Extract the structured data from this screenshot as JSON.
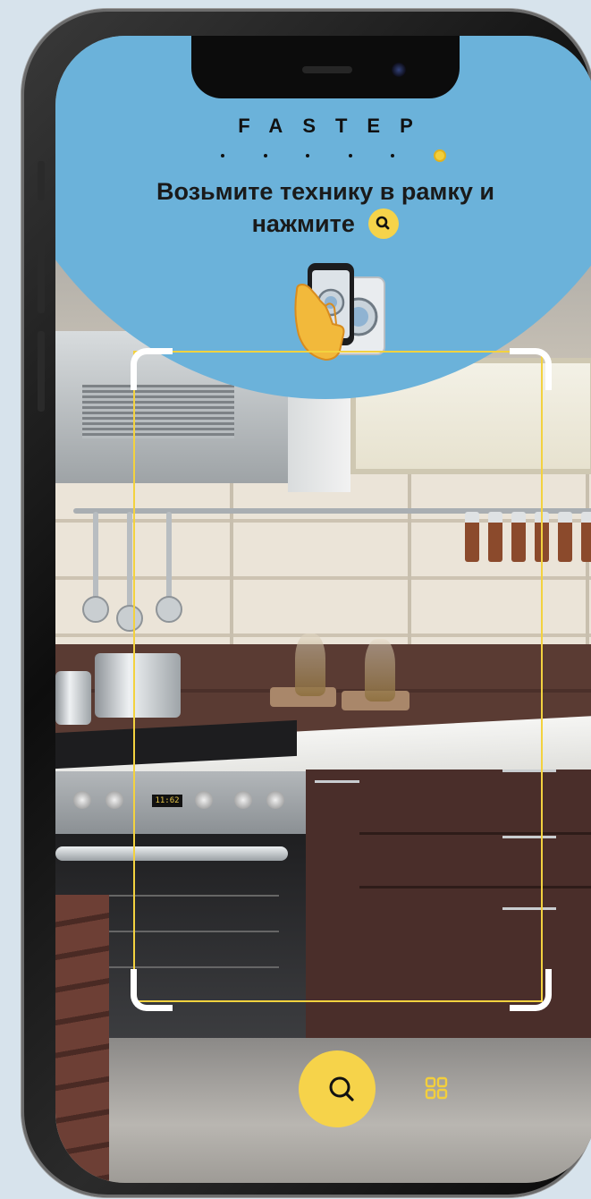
{
  "app": {
    "brand_logo": "FASTEP",
    "brand_letters": [
      "F",
      "A",
      "S",
      "T",
      "E",
      "P"
    ],
    "accent_color": "#f6d34a",
    "bubble_color": "#6bb2da",
    "frame_color": "#f3d23f"
  },
  "instructions": {
    "line1": "Возьмите технику в рамку и",
    "line2": "нажмите"
  },
  "camera_view": {
    "oven_display": "11:62"
  },
  "controls": {
    "scan_button_icon": "search-icon",
    "gallery_button_icon": "grid-icon",
    "inline_icon": "search-icon"
  }
}
